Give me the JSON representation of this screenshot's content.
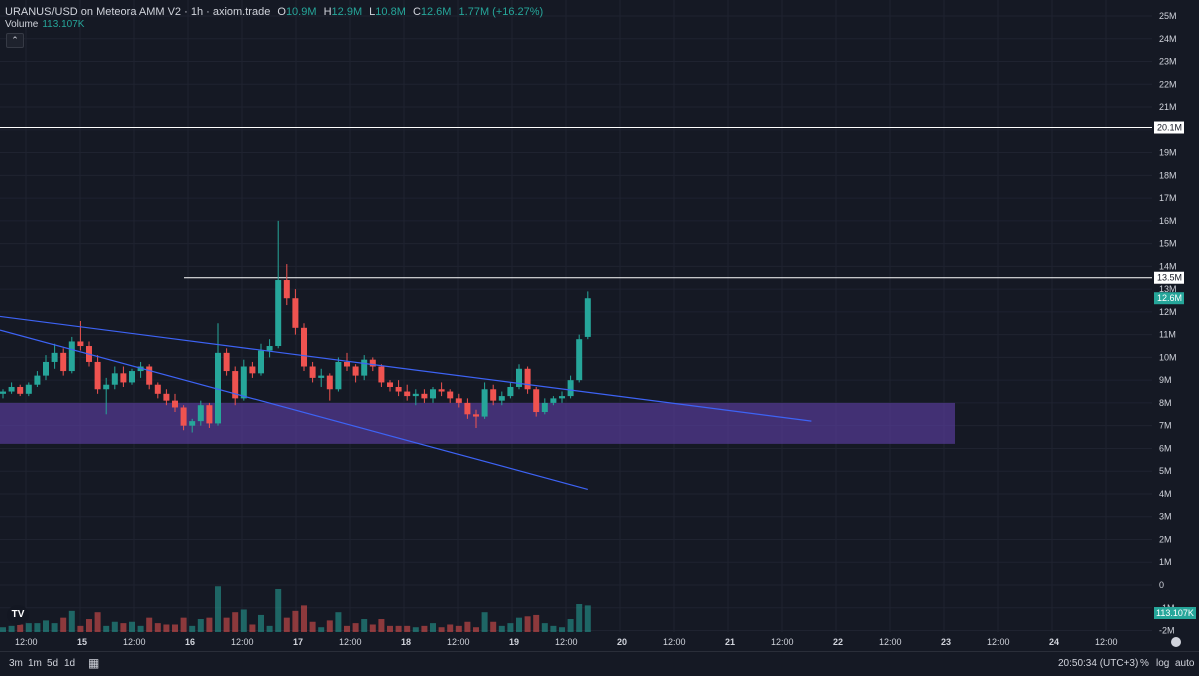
{
  "legend": {
    "symbol": "URANUS/USD on Meteora AMM V2 · 1h · axiom.trade",
    "o_label": "O",
    "o_value": "10.9M",
    "h_label": "H",
    "h_value": "12.9M",
    "l_label": "L",
    "l_value": "10.8M",
    "c_label": "C",
    "c_value": "12.6M",
    "change": "1.77M (+16.27%)"
  },
  "volume_legend": {
    "label": "Volume",
    "value": "113.107K"
  },
  "colors": {
    "up": "#26a69a",
    "down": "#ef5350",
    "trendline": "#3d63f5",
    "zone": "#5b3da0",
    "background": "#151924"
  },
  "bottom_bar": {
    "ranges": [
      "3m",
      "1m",
      "5d",
      "1d"
    ],
    "time": "20:50:34 (UTC+3)",
    "percent": "%",
    "log": "log",
    "auto": "auto"
  },
  "chart_data": {
    "type": "candlestick",
    "title": "URANUS/USD on Meteora AMM V2 · 1h · axiom.trade",
    "y_axis": {
      "ticks": [
        "25M",
        "24M",
        "23M",
        "22M",
        "21M",
        "19M",
        "18M",
        "17M",
        "16M",
        "15M",
        "14M",
        "13M",
        "12M",
        "11M",
        "10M",
        "9M",
        "8M",
        "7M",
        "6M",
        "5M",
        "4M",
        "3M",
        "2M",
        "1M",
        "0",
        "-1M",
        "-2M"
      ],
      "range": [
        -2000000,
        25500000
      ]
    },
    "x_axis": {
      "ticks": [
        "12:00",
        "15",
        "12:00",
        "16",
        "12:00",
        "17",
        "12:00",
        "18",
        "12:00",
        "19",
        "12:00",
        "20",
        "12:00",
        "21",
        "12:00",
        "22",
        "12:00",
        "23",
        "12:00",
        "24",
        "12:00"
      ]
    },
    "price_labels": [
      {
        "label": "20.1M",
        "value": 20100000
      },
      {
        "label": "13.5M",
        "value": 13500000
      },
      {
        "label": "12.6M",
        "value": 12600000
      },
      {
        "label": "113.107K",
        "value": "volume"
      }
    ],
    "horizontal_lines": [
      20100000,
      13500000
    ],
    "candles": [
      [
        8.4,
        8.6,
        8.2,
        8.5
      ],
      [
        8.5,
        8.9,
        8.4,
        8.7
      ],
      [
        8.7,
        8.8,
        8.3,
        8.4
      ],
      [
        8.4,
        8.9,
        8.3,
        8.8
      ],
      [
        8.8,
        9.4,
        8.7,
        9.2
      ],
      [
        9.2,
        10.1,
        9.0,
        9.8
      ],
      [
        9.8,
        10.6,
        9.5,
        10.2
      ],
      [
        10.2,
        10.4,
        9.2,
        9.4
      ],
      [
        9.4,
        10.9,
        9.3,
        10.7
      ],
      [
        10.7,
        11.6,
        10.3,
        10.5
      ],
      [
        10.5,
        10.7,
        9.6,
        9.8
      ],
      [
        9.8,
        10.1,
        8.4,
        8.6
      ],
      [
        8.6,
        9.1,
        7.5,
        8.8
      ],
      [
        8.8,
        9.6,
        8.6,
        9.3
      ],
      [
        9.3,
        9.6,
        8.7,
        8.9
      ],
      [
        8.9,
        9.5,
        8.8,
        9.4
      ],
      [
        9.4,
        9.8,
        9.1,
        9.6
      ],
      [
        9.6,
        9.7,
        8.6,
        8.8
      ],
      [
        8.8,
        8.9,
        8.2,
        8.4
      ],
      [
        8.4,
        8.6,
        7.9,
        8.1
      ],
      [
        8.1,
        8.4,
        7.6,
        7.8
      ],
      [
        7.8,
        7.9,
        6.8,
        7.0
      ],
      [
        7.0,
        7.3,
        6.7,
        7.2
      ],
      [
        7.2,
        8.1,
        7.0,
        7.9
      ],
      [
        7.9,
        8.0,
        6.9,
        7.1
      ],
      [
        7.1,
        11.5,
        7.0,
        10.2
      ],
      [
        10.2,
        10.4,
        9.2,
        9.4
      ],
      [
        9.4,
        9.6,
        7.9,
        8.2
      ],
      [
        8.2,
        9.9,
        8.1,
        9.6
      ],
      [
        9.6,
        9.8,
        9.1,
        9.3
      ],
      [
        9.3,
        10.6,
        9.2,
        10.3
      ],
      [
        10.3,
        10.8,
        10.0,
        10.5
      ],
      [
        10.5,
        16.0,
        10.4,
        13.4
      ],
      [
        13.4,
        14.1,
        12.3,
        12.6
      ],
      [
        12.6,
        13.0,
        11.0,
        11.3
      ],
      [
        11.3,
        11.5,
        9.4,
        9.6
      ],
      [
        9.6,
        9.8,
        8.9,
        9.1
      ],
      [
        9.1,
        9.5,
        8.7,
        9.2
      ],
      [
        9.2,
        9.3,
        8.1,
        8.6
      ],
      [
        8.6,
        10.0,
        8.5,
        9.8
      ],
      [
        9.8,
        10.2,
        9.4,
        9.6
      ],
      [
        9.6,
        9.7,
        8.9,
        9.2
      ],
      [
        9.2,
        10.1,
        9.0,
        9.9
      ],
      [
        9.9,
        10.0,
        9.4,
        9.6
      ],
      [
        9.6,
        9.7,
        8.7,
        8.9
      ],
      [
        8.9,
        9.0,
        8.5,
        8.7
      ],
      [
        8.7,
        9.0,
        8.3,
        8.5
      ],
      [
        8.5,
        8.8,
        8.1,
        8.3
      ],
      [
        8.3,
        8.6,
        7.9,
        8.4
      ],
      [
        8.4,
        8.6,
        8.0,
        8.2
      ],
      [
        8.2,
        8.7,
        8.0,
        8.6
      ],
      [
        8.6,
        8.9,
        8.3,
        8.5
      ],
      [
        8.5,
        8.6,
        8.0,
        8.2
      ],
      [
        8.2,
        8.4,
        7.8,
        8.0
      ],
      [
        8.0,
        8.2,
        7.3,
        7.5
      ],
      [
        7.5,
        7.7,
        6.9,
        7.4
      ],
      [
        7.4,
        8.9,
        7.3,
        8.6
      ],
      [
        8.6,
        8.8,
        7.9,
        8.1
      ],
      [
        8.1,
        8.5,
        7.9,
        8.3
      ],
      [
        8.3,
        8.9,
        8.2,
        8.7
      ],
      [
        8.7,
        9.7,
        8.6,
        9.5
      ],
      [
        9.5,
        9.6,
        8.4,
        8.6
      ],
      [
        8.6,
        8.7,
        7.4,
        7.6
      ],
      [
        7.6,
        8.2,
        7.5,
        8.0
      ],
      [
        8.0,
        8.3,
        7.9,
        8.2
      ],
      [
        8.2,
        8.5,
        8.0,
        8.3
      ],
      [
        8.3,
        9.2,
        8.2,
        9.0
      ],
      [
        9.0,
        11.0,
        8.9,
        10.8
      ],
      [
        10.9,
        12.9,
        10.8,
        12.6
      ]
    ],
    "volume_spikes_note": "",
    "trendlines": [
      {
        "from": [
          0,
          11.8
        ],
        "to": [
          94,
          7.2
        ]
      },
      {
        "from": [
          0,
          11.2
        ],
        "to": [
          68,
          4.2
        ]
      }
    ],
    "zones": [
      {
        "from": 6.2,
        "to": 8.0
      }
    ],
    "grid": true
  }
}
